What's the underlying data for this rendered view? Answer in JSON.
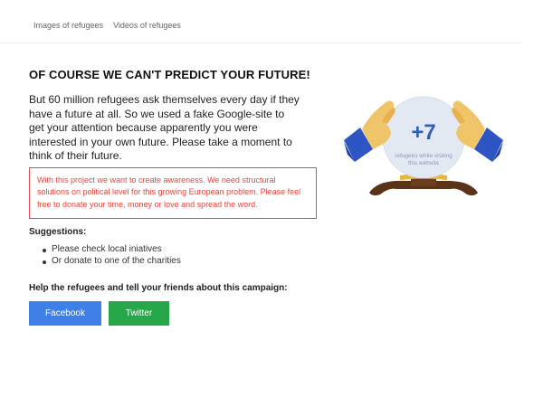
{
  "nav": {
    "images_label": "Images of refugees",
    "videos_label": "Videos of refugees"
  },
  "main": {
    "title": "OF COURSE WE CAN'T PREDICT YOUR FUTURE!",
    "intro": "But 60 million refugees ask themselves every day if they have a future at all. So we used a fake Google-site to get your attention because apparently you were interested in your own future. Please take a moment to think of their future.",
    "notice": "With this project we want to create awareness. We need structural solutions on political level for this growing European problem. Please feel free to donate your time, money or love and spread the word.",
    "suggestions_heading": "Suggestions:",
    "suggestions": [
      "Please check local iniatives",
      "Or donate to one of the charities"
    ],
    "help_text": "Help the refugees and tell your friends about this campaign:",
    "facebook_label": "Facebook",
    "twitter_label": "Twitter"
  },
  "crystal_ball": {
    "count": "+7",
    "caption_line1": "refugees while visiting",
    "caption_line2": "this website",
    "icon": "crystal-ball-with-hands-icon"
  },
  "colors": {
    "facebook": "#3e80e8",
    "twitter": "#27a74a",
    "notice_red": "#e24b4b",
    "count_blue": "#2f5fb3",
    "sleeve_blue": "#2e55c4",
    "hand_skin": "#f0c468"
  }
}
